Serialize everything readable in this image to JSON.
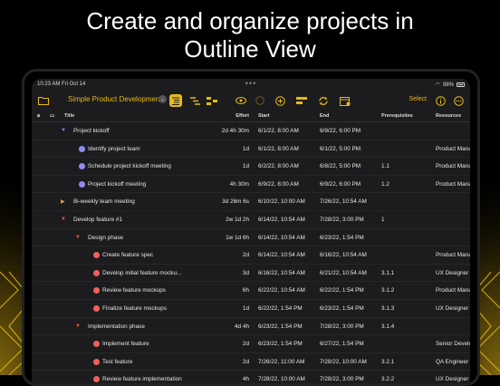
{
  "headline": {
    "line1": "Create and organize projects in",
    "line2": "Outline View"
  },
  "statusbar": {
    "time": "10:23 AM  Fri Oct 14",
    "dots": "•••",
    "battery": "98%"
  },
  "toolbar": {
    "document_title": "Simple Product Development",
    "select_label": "Select",
    "accent_color": "#e8b917"
  },
  "table": {
    "headers": {
      "title": "Title",
      "effort": "Effort",
      "start": "Start",
      "end": "End",
      "prerequisites": "Prerequisites",
      "resources": "Resources"
    },
    "rows": [
      {
        "title": "Project kickoff",
        "effort": "2d 4h 30m",
        "start": "6/1/22, 8:00 AM",
        "end": "6/9/22, 6:00 PM",
        "prereq": "",
        "resources": "",
        "kind": "group-blue"
      },
      {
        "title": "Identify project team",
        "effort": "1d",
        "start": "6/1/22, 8:00 AM",
        "end": "6/1/22, 5:00 PM",
        "prereq": "",
        "resources": "Product Manager",
        "kind": "task-purple"
      },
      {
        "title": "Schedule project kickoff meeting",
        "effort": "1d",
        "start": "6/2/22, 8:00 AM",
        "end": "6/8/22, 5:00 PM",
        "prereq": "1.1",
        "resources": "Product Manager",
        "kind": "task-purple"
      },
      {
        "title": "Project kickoff meeting",
        "effort": "4h 30m",
        "start": "6/9/22, 8:00 AM",
        "end": "6/9/22, 6:00 PM",
        "prereq": "1.2",
        "resources": "Product Manager; UX",
        "kind": "task-purple"
      },
      {
        "title": "Bi-weekly team meeting",
        "effort": "3d 26m 6s",
        "start": "6/10/22, 10:00 AM",
        "end": "7/26/22, 10:54 AM",
        "prereq": "",
        "resources": "",
        "kind": "group-orange"
      },
      {
        "title": "Develop feature #1",
        "effort": "2w 1d 2h",
        "start": "6/14/22, 10:54 AM",
        "end": "7/28/22, 3:00 PM",
        "prereq": "1",
        "resources": "",
        "kind": "group-red"
      },
      {
        "title": "Design phase",
        "effort": "1w 1d 6h",
        "start": "6/14/22, 10:54 AM",
        "end": "6/23/22, 1:54 PM",
        "prereq": "",
        "resources": "",
        "kind": "subgroup-red"
      },
      {
        "title": "Create feature spec",
        "effort": "2d",
        "start": "6/14/22, 10:54 AM",
        "end": "6/16/22, 10:54 AM",
        "prereq": "",
        "resources": "Product Manager",
        "kind": "task-red"
      },
      {
        "title": "Develop initial feature mocku...",
        "effort": "3d",
        "start": "6/16/22, 10:54 AM",
        "end": "6/21/22, 10:54 AM",
        "prereq": "3.1.1",
        "resources": "UX Designer",
        "kind": "task-red"
      },
      {
        "title": "Review feature mockups",
        "effort": "6h",
        "start": "6/22/22, 10:54 AM",
        "end": "6/22/22, 1:54 PM",
        "prereq": "3.1.2",
        "resources": "Product Manager; Se",
        "kind": "task-red"
      },
      {
        "title": "Finalize feature mockups",
        "effort": "1d",
        "start": "6/22/22, 1:54 PM",
        "end": "6/23/22, 1:54 PM",
        "prereq": "3.1.3",
        "resources": "UX Designer",
        "kind": "task-red"
      },
      {
        "title": "Implementation phase",
        "effort": "4d 4h",
        "start": "6/23/22, 1:54 PM",
        "end": "7/28/22, 3:00 PM",
        "prereq": "3.1.4",
        "resources": "",
        "kind": "subgroup-red"
      },
      {
        "title": "Implement feature",
        "effort": "2d",
        "start": "6/23/22, 1:54 PM",
        "end": "6/27/22, 1:54 PM",
        "prereq": "",
        "resources": "Senior Developer",
        "kind": "task-red"
      },
      {
        "title": "Test feature",
        "effort": "2d",
        "start": "7/26/22, 11:00 AM",
        "end": "7/28/22, 10:00 AM",
        "prereq": "3.2.1",
        "resources": "QA Engineer",
        "kind": "task-red"
      },
      {
        "title": "Review feature implementation",
        "effort": "4h",
        "start": "7/28/22, 10:00 AM",
        "end": "7/28/22, 3:00 PM",
        "prereq": "3.2.2",
        "resources": "UX Designer",
        "kind": "task-red"
      }
    ]
  }
}
